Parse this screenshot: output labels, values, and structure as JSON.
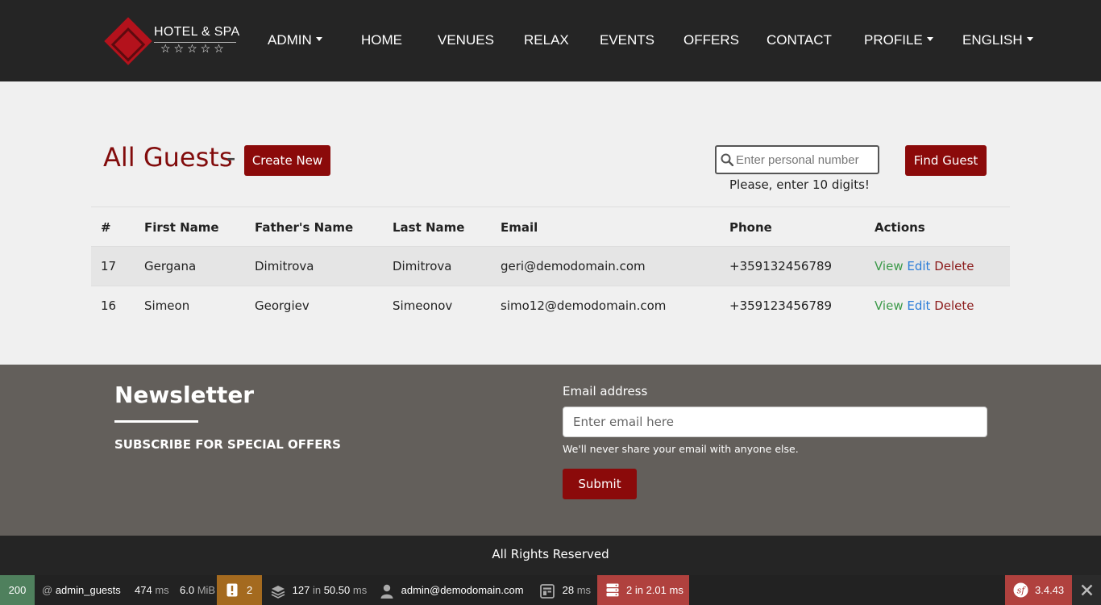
{
  "nav": {
    "logo_text": "HOTEL & SPA",
    "logo_stars": "☆☆☆☆☆",
    "items": [
      {
        "label": "ADMIN",
        "dropdown": true
      },
      {
        "label": "HOME",
        "dropdown": false
      },
      {
        "label": "VENUES",
        "dropdown": false
      },
      {
        "label": "RELAX",
        "dropdown": false
      },
      {
        "label": "EVENTS",
        "dropdown": false
      },
      {
        "label": "OFFERS",
        "dropdown": false
      },
      {
        "label": "CONTACT",
        "dropdown": false
      },
      {
        "label": "PROFILE",
        "dropdown": true
      },
      {
        "label": "ENGLISH",
        "dropdown": true
      }
    ]
  },
  "header": {
    "title": "All Guests",
    "separator": "-",
    "create_label": "Create New",
    "search_placeholder": "Enter personal number",
    "find_label": "Find Guest",
    "hint": "Please, enter 10 digits!"
  },
  "table": {
    "columns": [
      "#",
      "First Name",
      "Father's Name",
      "Last Name",
      "Email",
      "Phone",
      "Actions"
    ],
    "rows": [
      {
        "id": "17",
        "first": "Gergana",
        "father": "Dimitrova",
        "last": "Dimitrova",
        "email": "geri@demodomain.com",
        "phone": "+359132456789"
      },
      {
        "id": "16",
        "first": "Simeon",
        "father": "Georgiev",
        "last": "Simeonov",
        "email": "simo12@demodomain.com",
        "phone": "+359123456789"
      }
    ],
    "actions": {
      "view": "View",
      "edit": "Edit",
      "delete": "Delete"
    }
  },
  "newsletter": {
    "title": "Newsletter",
    "subtitle": "SUBSCRIBE FOR SPECIAL OFFERS",
    "email_label": "Email address",
    "email_placeholder": "Enter email here",
    "help": "We'll never share your email with anyone else.",
    "submit_label": "Submit"
  },
  "footer": {
    "text": "All Rights Reserved"
  },
  "debug_toolbar": {
    "status": "200",
    "route_prefix": "@",
    "route": "admin_guests",
    "time": "474",
    "time_unit": "ms",
    "memory": "6.0",
    "memory_unit": "MiB",
    "logs": "2",
    "cache_count": "127",
    "cache_in": "in",
    "cache_time": "50.50",
    "cache_unit": "ms",
    "user": "admin@demodomain.com",
    "twig_time": "28",
    "twig_unit": "ms",
    "db_queries": "2 in 2.01 ms",
    "version": "3.4.43",
    "colors": {
      "status": "#4f805d",
      "logs": "#a46a1f",
      "db": "#b0413e",
      "version": "#b0413e"
    }
  }
}
